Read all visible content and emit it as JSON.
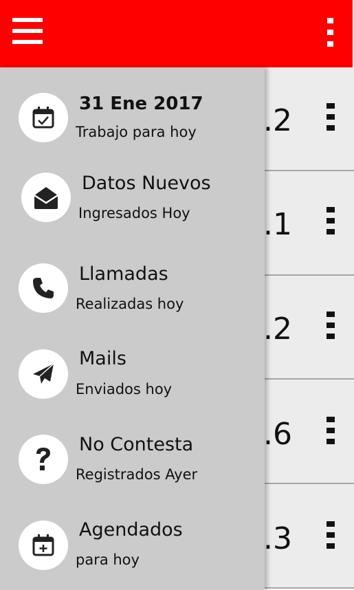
{
  "colors": {
    "appbar": "#ff0000",
    "drawer": "#cbcbcb",
    "list_bg": "#ececec"
  },
  "appbar": {
    "menu_icon": "hamburger-icon",
    "more_icon": "more-vert-icon"
  },
  "list": {
    "rows": [
      {
        "value": ".2"
      },
      {
        "value": ".1"
      },
      {
        "value": ".2"
      },
      {
        "value": ".6"
      },
      {
        "value": ".3"
      }
    ]
  },
  "drawer": {
    "items": [
      {
        "icon": "calendar-check-icon",
        "title": "31 Ene 2017",
        "subtitle": "Trabajo para hoy"
      },
      {
        "icon": "envelope-open-icon",
        "title": "Datos Nuevos",
        "subtitle": "Ingresados Hoy"
      },
      {
        "icon": "phone-icon",
        "title": "Llamadas",
        "subtitle": "Realizadas hoy"
      },
      {
        "icon": "paper-plane-icon",
        "title": "Mails",
        "subtitle": "Enviados hoy"
      },
      {
        "icon": "question-icon",
        "title": "No Contesta",
        "subtitle": "Registrados Ayer"
      },
      {
        "icon": "calendar-plus-icon",
        "title": "Agendados",
        "subtitle": "para hoy"
      }
    ]
  }
}
